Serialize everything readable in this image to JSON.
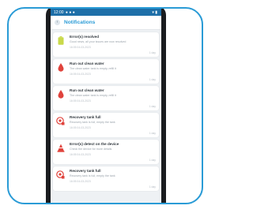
{
  "statusbar": {
    "time": "12:00",
    "icons_left": "● ● ●",
    "icons_right": "▾ ▮"
  },
  "appbar": {
    "back_glyph": "‹",
    "title": "Notifications"
  },
  "notifications": [
    {
      "icon": "battery-icon",
      "icon_color": "#c9d94a",
      "title": "Error(s) resolved",
      "description": "Good news, all your issues are now resolved",
      "date": "16:05 04-03-2023",
      "ago": "1 day"
    },
    {
      "icon": "water-drop-icon",
      "icon_color": "#e0433c",
      "title": "Run out clean water",
      "description": "The clean water tank is empty, refill it",
      "date": "16:05 04-03-2023",
      "ago": "1 day"
    },
    {
      "icon": "water-drop-icon",
      "icon_color": "#e0433c",
      "title": "Run out clean water",
      "description": "The clean water tank is empty, refill it",
      "date": "16:05 04-03-2023",
      "ago": "1 day"
    },
    {
      "icon": "recovery-tank-icon",
      "icon_color": "#e0433c",
      "title": "Recovery tank full",
      "description": "Recovery tank is full, empty the tank",
      "date": "16:05 04-03-2023",
      "ago": "1 day"
    },
    {
      "icon": "warning-cone-icon",
      "icon_color": "#e0433c",
      "title": "Error(s) detect on the device",
      "description": "Check the device for more details",
      "date": "16:05 04-03-2023",
      "ago": "1 day"
    },
    {
      "icon": "recovery-tank-icon",
      "icon_color": "#e0433c",
      "title": "Recovery tank full",
      "description": "Recovery tank is full, empty the tank",
      "date": "16:05 04-03-2023",
      "ago": "1 day"
    }
  ]
}
